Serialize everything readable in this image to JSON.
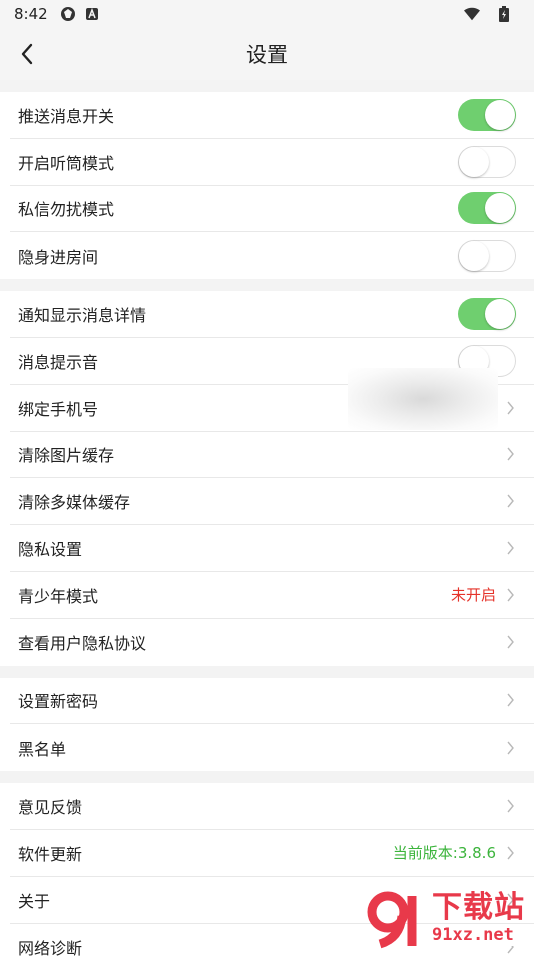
{
  "status": {
    "time": "8:42"
  },
  "header": {
    "title": "设置"
  },
  "groups": [
    {
      "rows": [
        {
          "label": "推送消息开关",
          "type": "toggle",
          "on": true
        },
        {
          "label": "开启听筒模式",
          "type": "toggle",
          "on": false
        },
        {
          "label": "私信勿扰模式",
          "type": "toggle",
          "on": true
        },
        {
          "label": "隐身进房间",
          "type": "toggle",
          "on": false
        }
      ]
    },
    {
      "rows": [
        {
          "label": "通知显示消息详情",
          "type": "toggle",
          "on": true
        },
        {
          "label": "消息提示音",
          "type": "toggle",
          "on": false
        },
        {
          "label": "绑定手机号",
          "type": "link"
        },
        {
          "label": "清除图片缓存",
          "type": "link"
        },
        {
          "label": "清除多媒体缓存",
          "type": "link"
        },
        {
          "label": "隐私设置",
          "type": "link"
        },
        {
          "label": "青少年模式",
          "type": "link",
          "value": "未开启",
          "value_color": "red"
        },
        {
          "label": "查看用户隐私协议",
          "type": "link"
        }
      ]
    },
    {
      "rows": [
        {
          "label": "设置新密码",
          "type": "link"
        },
        {
          "label": "黑名单",
          "type": "link"
        }
      ]
    },
    {
      "rows": [
        {
          "label": "意见反馈",
          "type": "link"
        },
        {
          "label": "软件更新",
          "type": "link",
          "value": "当前版本:3.8.6",
          "value_color": "green"
        },
        {
          "label": "关于",
          "type": "link"
        },
        {
          "label": "网络诊断",
          "type": "link"
        }
      ]
    }
  ],
  "watermark": {
    "top": "下载站",
    "bottom": "91xz.net"
  },
  "colors": {
    "toggle_on": "#6fcf6f",
    "red": "#e5332a",
    "green": "#3cb43c"
  }
}
